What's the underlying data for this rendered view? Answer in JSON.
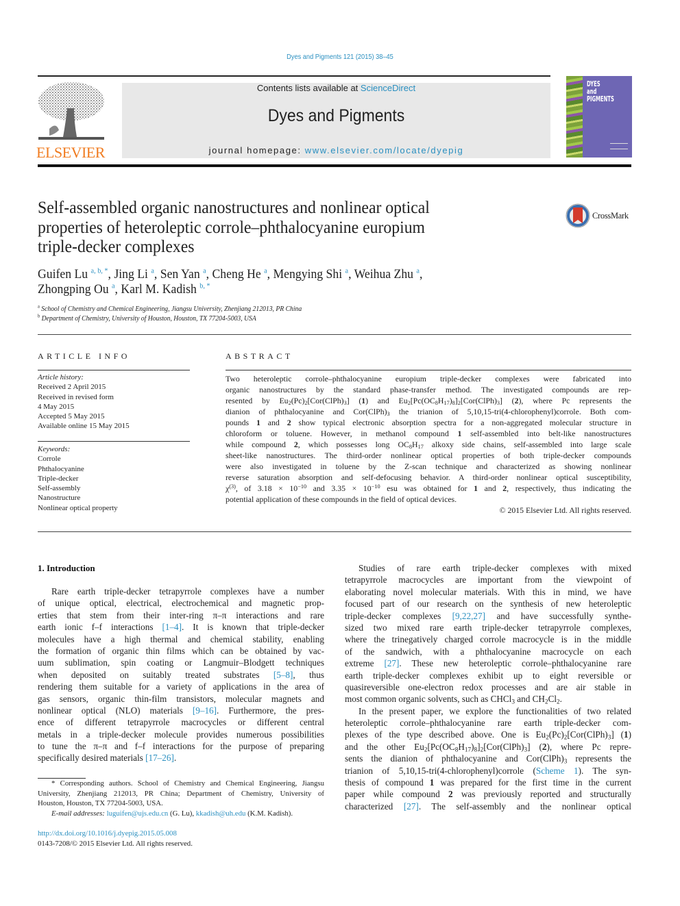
{
  "header": {
    "journal_reference": "Dyes and Pigments 121 (2015) 38–45",
    "contents_prefix": "Contents lists available at ",
    "contents_link": "ScienceDirect",
    "journal_name": "Dyes and Pigments",
    "homepage_prefix": "journal homepage: ",
    "homepage_link": "www.elsevier.com/locate/dyepig",
    "publisher_logo_text": "ELSEVIER",
    "cover_title_lines": [
      "DYES",
      "and",
      "PIGMENTS"
    ],
    "crossmark_label": "CrossMark",
    "colors": {
      "link": "#2a8fc0",
      "elsevier_orange": "#f07c21",
      "cover_purple": "#6e66b4",
      "masthead_gray": "#e8e8e8"
    }
  },
  "article": {
    "title_lines": [
      "Self-assembled organic nanostructures and nonlinear optical",
      "properties of heteroleptic corrole–phthalocyanine europium",
      "triple-decker complexes"
    ],
    "authors": [
      [
        {
          "name": "Guifen Lu",
          "sup": "a, b, *"
        },
        {
          "name": "Jing Li",
          "sup": "a"
        },
        {
          "name": "Sen Yan",
          "sup": "a"
        },
        {
          "name": "Cheng He",
          "sup": "a"
        },
        {
          "name": "Mengying Shi",
          "sup": "a"
        },
        {
          "name": "Weihua Zhu",
          "sup": "a",
          "trail": ","
        }
      ],
      [
        {
          "name": "Zhongping Ou",
          "sup": "a"
        },
        {
          "name": "Karl M. Kadish",
          "sup": "b, *",
          "last": true
        }
      ]
    ],
    "affiliations": [
      {
        "mark": "a",
        "text": "School of Chemistry and Chemical Engineering, Jiangsu University, Zhenjiang 212013, PR China"
      },
      {
        "mark": "b",
        "text": "Department of Chemistry, University of Houston, Houston, TX 77204-5003, USA"
      }
    ]
  },
  "article_info": {
    "heading": "ARTICLE INFO",
    "history_label": "Article history:",
    "history": [
      "Received 2 April 2015",
      "Received in revised form",
      "4 May 2015",
      "Accepted 5 May 2015",
      "Available online 15 May 2015"
    ],
    "keywords_label": "Keywords:",
    "keywords": [
      "Corrole",
      "Phthalocyanine",
      "Triple-decker",
      "Self-assembly",
      "Nanostructure",
      "Nonlinear optical property"
    ]
  },
  "abstract": {
    "heading": "ABSTRACT",
    "lines": [
      [
        {
          "t": "Two heteroleptic corrole–phthalocyanine europium triple-decker complexes were fabricated into"
        }
      ],
      [
        {
          "t": "organic nanostructures by the standard phase-transfer method. The investigated compounds are rep-"
        }
      ],
      [
        {
          "t": "resented by Eu"
        },
        {
          "sub": "2"
        },
        {
          "t": "(Pc)"
        },
        {
          "sub": "2"
        },
        {
          "t": "[Cor(ClPh)"
        },
        {
          "sub": "3"
        },
        {
          "t": "] ("
        },
        {
          "b": "1"
        },
        {
          "t": ") and Eu"
        },
        {
          "sub": "2"
        },
        {
          "t": "[Pc(OC"
        },
        {
          "sub": "8"
        },
        {
          "t": "H"
        },
        {
          "sub": "17"
        },
        {
          "t": ")"
        },
        {
          "sub": "8"
        },
        {
          "t": "]"
        },
        {
          "sub": "2"
        },
        {
          "t": "[Cor(ClPh)"
        },
        {
          "sub": "3"
        },
        {
          "t": "] ("
        },
        {
          "b": "2"
        },
        {
          "t": "), where Pc represents the"
        }
      ],
      [
        {
          "t": "dianion of phthalocyanine and Cor(ClPh)"
        },
        {
          "sub": "3"
        },
        {
          "t": " the trianion of 5,10,15-tri(4-chlorophenyl)corrole. Both com-"
        }
      ],
      [
        {
          "t": "pounds "
        },
        {
          "b": "1"
        },
        {
          "t": " and "
        },
        {
          "b": "2"
        },
        {
          "t": " show typical electronic absorption spectra for a non-aggregated molecular structure in"
        }
      ],
      [
        {
          "t": "chloroform or toluene. However, in methanol compound "
        },
        {
          "b": "1"
        },
        {
          "t": " self-assembled into belt-like nanostructures"
        }
      ],
      [
        {
          "t": "while compound "
        },
        {
          "b": "2"
        },
        {
          "t": ", which possesses long OC"
        },
        {
          "sub": "8"
        },
        {
          "t": "H"
        },
        {
          "sub": "17"
        },
        {
          "t": " alkoxy side chains, self-assembled into large scale"
        }
      ],
      [
        {
          "t": "sheet-like nanostructures. The third-order nonlinear optical properties of both triple-decker compounds"
        }
      ],
      [
        {
          "t": "were also investigated in toluene by the Z-scan technique and characterized as showing nonlinear"
        }
      ],
      [
        {
          "t": "reverse saturation absorption and self-defocusing behavior. A third-order nonlinear optical susceptibility,"
        }
      ],
      [
        {
          "t": "χ"
        },
        {
          "sup": "(3)"
        },
        {
          "t": ", of 3.18 × 10"
        },
        {
          "sup": "−10"
        },
        {
          "t": " and 3.35 × 10"
        },
        {
          "sup": "−10"
        },
        {
          "t": " esu was obtained for "
        },
        {
          "b": "1"
        },
        {
          "t": " and "
        },
        {
          "b": "2"
        },
        {
          "t": ", respectively, thus indicating the"
        }
      ],
      [
        {
          "t": "potential application of these compounds in the field of optical devices."
        }
      ]
    ],
    "copyright": "© 2015 Elsevier Ltd. All rights reserved."
  },
  "introduction": {
    "heading": "1.  Introduction",
    "left_lines": [
      [
        {
          "t": "Rare earth triple-decker tetrapyrrole complexes have a number"
        }
      ],
      [
        {
          "t": "of unique optical, electrical, electrochemical and magnetic prop-"
        }
      ],
      [
        {
          "t": "erties that stem from their inter-ring π–π interactions and rare"
        }
      ],
      [
        {
          "t": "earth ionic f–f interactions "
        },
        {
          "a": "[1–4]"
        },
        {
          "t": ". It is known that triple-decker"
        }
      ],
      [
        {
          "t": "molecules have a high thermal and chemical stability, enabling"
        }
      ],
      [
        {
          "t": "the formation of organic thin films which can be obtained by vac-"
        }
      ],
      [
        {
          "t": "uum sublimation, spin coating or Langmuir–Blodgett techniques"
        }
      ],
      [
        {
          "t": "when deposited on suitably treated substrates "
        },
        {
          "a": "[5–8]"
        },
        {
          "t": ", thus"
        }
      ],
      [
        {
          "t": "rendering them suitable for a variety of applications in the area of"
        }
      ],
      [
        {
          "t": "gas sensors, organic thin-film transistors, molecular magnets and"
        }
      ],
      [
        {
          "t": "nonlinear optical (NLO) materials "
        },
        {
          "a": "[9–16]"
        },
        {
          "t": ". Furthermore, the pres-"
        }
      ],
      [
        {
          "t": "ence of different tetrapyrrole macrocycles or different central"
        }
      ],
      [
        {
          "t": "metals in a triple-decker molecule provides numerous possibilities"
        }
      ],
      [
        {
          "t": "to tune the π–π and f–f interactions for the purpose of preparing"
        }
      ],
      [
        {
          "t": "specifically desired materials "
        },
        {
          "a": "[17–26]"
        },
        {
          "t": "."
        }
      ]
    ],
    "right_lines": [
      [
        {
          "t": "Studies of rare earth triple-decker complexes with mixed"
        }
      ],
      [
        {
          "t": "tetrapyrrole macrocycles are important from the viewpoint of"
        }
      ],
      [
        {
          "t": "elaborating novel molecular materials. With this in mind, we have"
        }
      ],
      [
        {
          "t": "focused part of our research on the synthesis of new heteroleptic"
        }
      ],
      [
        {
          "t": "triple-decker complexes "
        },
        {
          "a": "[9,22,27]"
        },
        {
          "t": " and have successfully synthe-"
        }
      ],
      [
        {
          "t": "sized two mixed rare earth triple-decker tetrapyrrole complexes,"
        }
      ],
      [
        {
          "t": "where the trinegatively charged corrole macrocycle is in the middle"
        }
      ],
      [
        {
          "t": "of the sandwich, with a phthalocyanine macrocycle on each"
        }
      ],
      [
        {
          "t": "extreme "
        },
        {
          "a": "[27]"
        },
        {
          "t": ". These new heteroleptic corrole–phthalocyanine rare"
        }
      ],
      [
        {
          "t": "earth triple-decker complexes exhibit up to eight reversible or"
        }
      ],
      [
        {
          "t": "quasireversible one-electron redox processes and are air stable in"
        }
      ],
      [
        {
          "t": "most common organic solvents, such as CHCl"
        },
        {
          "sub": "3"
        },
        {
          "t": " and CH"
        },
        {
          "sub": "2"
        },
        {
          "t": "Cl"
        },
        {
          "sub": "2"
        },
        {
          "t": "."
        }
      ],
      [
        {
          "t": "In the present paper, we explore the functionalities of two related"
        }
      ],
      [
        {
          "t": "heteroleptic corrole–phthalocyanine rare earth triple-decker com-"
        }
      ],
      [
        {
          "t": "plexes of the type described above. One is Eu"
        },
        {
          "sub": "2"
        },
        {
          "t": "(Pc)"
        },
        {
          "sub": "2"
        },
        {
          "t": "[Cor(ClPh)"
        },
        {
          "sub": "3"
        },
        {
          "t": "] ("
        },
        {
          "b": "1"
        },
        {
          "t": ")"
        }
      ],
      [
        {
          "t": "and the other Eu"
        },
        {
          "sub": "2"
        },
        {
          "t": "[Pc(OC"
        },
        {
          "sub": "8"
        },
        {
          "t": "H"
        },
        {
          "sub": "17"
        },
        {
          "t": ")"
        },
        {
          "sub": "8"
        },
        {
          "t": "]"
        },
        {
          "sub": "2"
        },
        {
          "t": "[Cor(ClPh)"
        },
        {
          "sub": "3"
        },
        {
          "t": "] ("
        },
        {
          "b": "2"
        },
        {
          "t": "), where Pc repre-"
        }
      ],
      [
        {
          "t": "sents the dianion of phthalocyanine and Cor(ClPh)"
        },
        {
          "sub": "3"
        },
        {
          "t": " represents the"
        }
      ],
      [
        {
          "t": "trianion of 5,10,15-tri(4-chlorophenyl)corrole ("
        },
        {
          "a": "Scheme 1"
        },
        {
          "t": "). The syn-"
        }
      ],
      [
        {
          "t": "thesis of compound "
        },
        {
          "b": "1"
        },
        {
          "t": " was prepared for the first time in the current"
        }
      ],
      [
        {
          "t": "paper while compound "
        },
        {
          "b": "2"
        },
        {
          "t": " was previously reported and structurally"
        }
      ],
      [
        {
          "t": "characterized "
        },
        {
          "a": "[27]"
        },
        {
          "t": ". The self-assembly and the nonlinear optical"
        }
      ]
    ],
    "right_indent_lines": [
      0,
      12
    ],
    "right_last_lines": [
      11
    ]
  },
  "footnotes": {
    "lines": [
      [
        {
          "t": "* Corresponding authors. School of Chemistry and Chemical Engineering, Jiangsu"
        }
      ],
      [
        {
          "t": "University, Zhenjiang 212013, PR China; Department of Chemistry, University of"
        }
      ],
      [
        {
          "t": "Houston, Houston, TX 77204-5003, USA."
        }
      ]
    ],
    "email_label": "E-mail addresses: ",
    "emails": [
      {
        "address": "luguifen@ujs.edu.cn",
        "owner": " (G. Lu), "
      },
      {
        "address": "kkadish@uh.edu",
        "owner": " (K.M. Kadish)."
      }
    ],
    "doi": "http://dx.doi.org/10.1016/j.dyepig.2015.05.008",
    "issn_copyright": "0143-7208/© 2015 Elsevier Ltd. All rights reserved."
  }
}
